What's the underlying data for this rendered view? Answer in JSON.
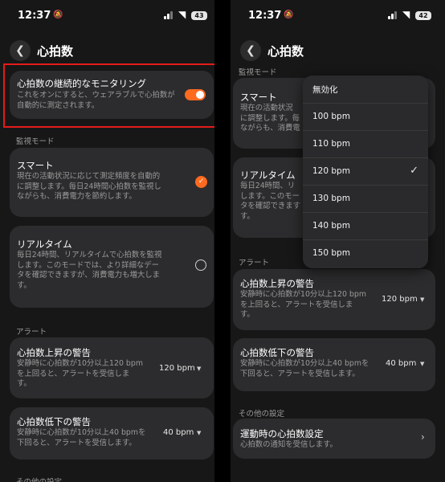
{
  "left": {
    "status": {
      "time": "12:37",
      "battery": "43"
    },
    "header": {
      "title": "心拍数"
    },
    "continuous": {
      "title": "心拍数の継続的なモニタリング",
      "desc": [
        "これをオンにすると、ウェアラブルで心拍数が",
        "自動的に測定されます。"
      ],
      "enabled": true
    },
    "mode_section": "監視モード",
    "smart": {
      "title": "スマート",
      "desc": [
        "現在の活動状況に応じて測定頻度を自動的",
        "に調整します。毎日24時間心拍数を監視し",
        "ながらも、消費電力を節約します。"
      ],
      "selected": true
    },
    "realtime": {
      "title": "リアルタイム",
      "desc": [
        "毎日24時間、リアルタイムで心拍数を監視",
        "します。このモードでは、より詳細なデー",
        "タを確認できますが、消費電力も増大しま",
        "す。"
      ],
      "selected": false
    },
    "alert_section": "アラート",
    "high": {
      "title": "心拍数上昇の警告",
      "desc": [
        "安静時に心拍数が10分以上120 bpm",
        "を上回ると、アラートを受信しま",
        "す。"
      ],
      "value": "120 bpm"
    },
    "low": {
      "title": "心拍数低下の警告",
      "desc": [
        "安静時に心拍数が10分以上40 bpmを",
        "下回ると、アラートを受信します。"
      ],
      "value": "40 bpm"
    },
    "other_section": "その他の設定"
  },
  "right": {
    "status": {
      "time": "12:37",
      "battery": "42"
    },
    "header": {
      "title": "心拍数"
    },
    "mode_section": "監視モード",
    "smart": {
      "title": "スマート",
      "desc": [
        "現在の活動状況",
        "に調整します。毎",
        "ながらも、消費電"
      ]
    },
    "realtime": {
      "title": "リアルタイム",
      "desc": [
        "毎日24時間、リ",
        "します。このモー",
        "タを確認できます",
        "す。"
      ]
    },
    "alert_section": "アラート",
    "high": {
      "title": "心拍数上昇の警告",
      "desc": [
        "安静時に心拍数が10分以上120 bpm",
        "を上回ると、アラートを受信しま",
        "す。"
      ],
      "value": "120 bpm"
    },
    "low": {
      "title": "心拍数低下の警告",
      "desc": [
        "安静時に心拍数が10分以上40 bpmを",
        "下回ると、アラートを受信します。"
      ],
      "value": "40 bpm"
    },
    "other_section": "その他の設定",
    "exercise": {
      "title": "運動時の心拍数設定",
      "desc": "心拍数の通知を受信します。"
    },
    "dropdown": {
      "options": [
        "無効化",
        "100 bpm",
        "110 bpm",
        "120 bpm",
        "130 bpm",
        "140 bpm",
        "150 bpm"
      ],
      "selected": "120 bpm"
    }
  },
  "colors": {
    "accent": "#ff6a1f",
    "highlight": "#e51b1b",
    "card": "#2c2c2e",
    "background": "#171717"
  }
}
